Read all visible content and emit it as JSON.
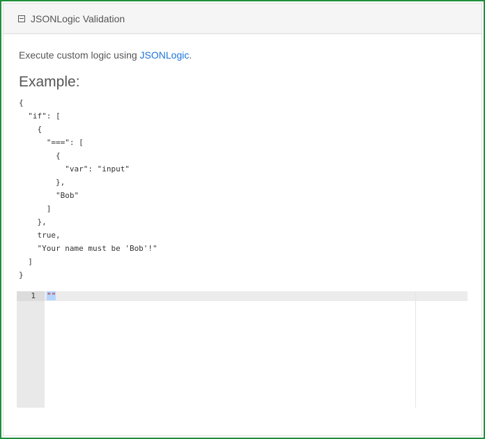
{
  "panel": {
    "title": "JSONLogic Validation",
    "collapse_icon": "minus-square-icon"
  },
  "description": {
    "prefix": "Execute custom logic using ",
    "link_text": "JSONLogic",
    "suffix": "."
  },
  "example": {
    "heading": "Example:",
    "code": "{\n  \"if\": [\n    {\n      \"===\": [\n        {\n          \"var\": \"input\"\n        },\n        \"Bob\"\n      ]\n    },\n    true,\n    \"Your name must be 'Bob'!\"\n  ]\n}"
  },
  "editor": {
    "line_number": "1",
    "content": "\"\""
  }
}
